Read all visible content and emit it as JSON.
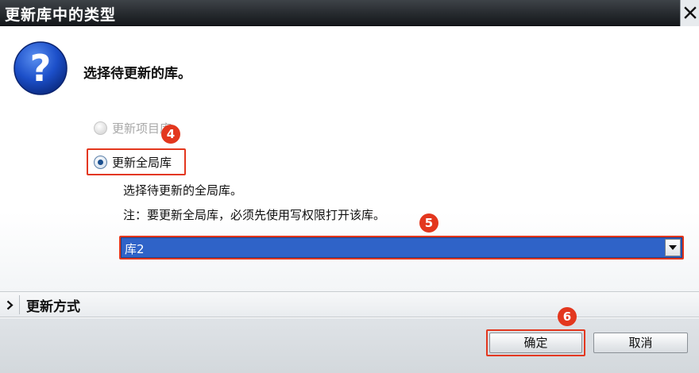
{
  "window": {
    "title": "更新库中的类型"
  },
  "dialog": {
    "heading": "选择待更新的库。"
  },
  "options": {
    "project_library": {
      "label": "更新项目库",
      "enabled": false,
      "selected": false
    },
    "global_library": {
      "label": "更新全局库",
      "enabled": true,
      "selected": true
    }
  },
  "info": {
    "line1": "选择待更新的全局库。",
    "line2": "注：要更新全局库，必须先使用写权限打开该库。"
  },
  "library_select": {
    "value": "库2"
  },
  "update_mode": {
    "label": "更新方式",
    "expanded": false
  },
  "buttons": {
    "ok": "确定",
    "cancel": "取消"
  },
  "annotations": {
    "step4": "4",
    "step5": "5",
    "step6": "6"
  },
  "colors": {
    "highlight": "#e3371e",
    "selection": "#2f63c8",
    "title_bar": "#262a2e"
  },
  "icons": {
    "dialog": "question-icon",
    "close": "close-icon",
    "dropdown": "chevron-down-icon",
    "expand": "chevron-right-icon"
  }
}
